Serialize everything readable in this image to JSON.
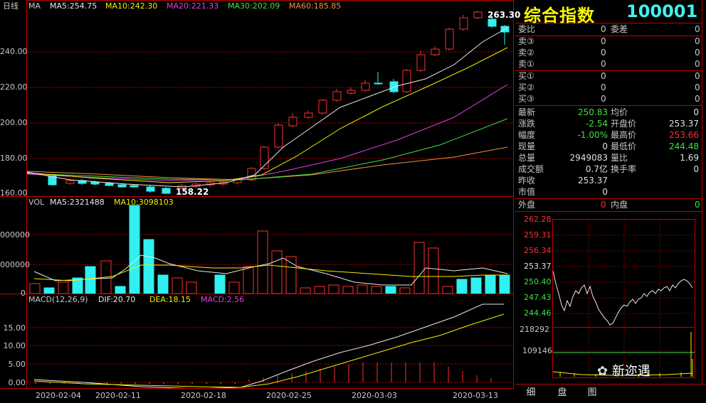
{
  "kline": {
    "period_label": "日线",
    "ma_labels": [
      {
        "text": "MA",
        "color": "#c8c8c8"
      },
      {
        "text": "MA5:254.75",
        "color": "#e8e8e8"
      },
      {
        "text": "MA10:242.30",
        "color": "#f0f000"
      },
      {
        "text": "MA20:221.33",
        "color": "#e040e0"
      },
      {
        "text": "MA30:202.09",
        "color": "#40e040"
      },
      {
        "text": "MA60:185.85",
        "color": "#f09040"
      }
    ],
    "y_ticks": [
      "240.00",
      "220.00",
      "200.00",
      "180.00",
      "160.00"
    ],
    "high_marker": "263.30",
    "low_marker": "158.22",
    "colors": {
      "up": "#ff3030",
      "down": "#30f0f0",
      "ma5": "#e8e8e8",
      "ma10": "#f0f000",
      "ma20": "#e040e0",
      "ma30": "#40e040",
      "ma60": "#f09040"
    }
  },
  "vol": {
    "labels": [
      {
        "text": "VOL",
        "color": "#c8c8c8"
      },
      {
        "text": "MA5:2321488",
        "color": "#e8e8e8"
      },
      {
        "text": "MA10:3098103",
        "color": "#f0f000"
      }
    ],
    "y_ticks": [
      "000000",
      "000000",
      "0"
    ]
  },
  "macd": {
    "labels": [
      {
        "text": "MACD(12,26,9)",
        "color": "#c8c8c8"
      },
      {
        "text": "DIF:20.70",
        "color": "#e8e8e8"
      },
      {
        "text": "DEA:18.15",
        "color": "#f0f000"
      },
      {
        "text": "MACD:2.56",
        "color": "#e040e0"
      }
    ],
    "y_ticks": [
      "15.00",
      "10.00",
      "5.00",
      "0.00"
    ]
  },
  "dates": [
    "2020-02-04",
    "2020-02-11",
    "2020-02-18",
    "2020-02-25",
    "2020-03-03",
    "2020-03-13"
  ],
  "quote": {
    "name": "综合指数",
    "code": "100001",
    "weibi_label": "委比",
    "weibi": "0",
    "weicha_label": "委差",
    "weicha": "0",
    "asks": [
      {
        "label": "卖③",
        "price": "0",
        "vol": "0"
      },
      {
        "label": "卖②",
        "price": "0",
        "vol": "0"
      },
      {
        "label": "卖①",
        "price": "0",
        "vol": "0"
      }
    ],
    "bids": [
      {
        "label": "买①",
        "price": "0",
        "vol": "0"
      },
      {
        "label": "买②",
        "price": "0",
        "vol": "0"
      },
      {
        "label": "买③",
        "price": "0",
        "vol": "0"
      }
    ],
    "stats": [
      {
        "l1": "最新",
        "v1": "250.83",
        "c1": "#40e040",
        "l2": "均价",
        "v2": "0",
        "c2": "#e0e0e0"
      },
      {
        "l1": "涨跌",
        "v1": "-2.54",
        "c1": "#40e040",
        "l2": "开盘价",
        "v2": "253.37",
        "c2": "#e0e0e0"
      },
      {
        "l1": "幅度",
        "v1": "-1.00%",
        "c1": "#40e040",
        "l2": "最高价",
        "v2": "253.66",
        "c2": "#ff3030"
      },
      {
        "l1": "现量",
        "v1": "0",
        "c1": "#e0e0e0",
        "l2": "最低价",
        "v2": "244.48",
        "c2": "#40e040"
      },
      {
        "l1": "总量",
        "v1": "2949083",
        "c1": "#e0e0e0",
        "l2": "量比",
        "v2": "1.69",
        "c2": "#e0e0e0"
      },
      {
        "l1": "成交额",
        "v1": "0.7亿",
        "c1": "#e0e0e0",
        "l2": "换手率",
        "v2": "0",
        "c2": "#e0e0e0"
      },
      {
        "l1": "昨收",
        "v1": "253.37",
        "c1": "#e0e0e0",
        "l2": "",
        "v2": "",
        "c2": "#e0e0e0"
      },
      {
        "l1": "市值",
        "v1": "0",
        "c1": "#e0e0e0",
        "l2": "",
        "v2": "",
        "c2": "#e0e0e0"
      }
    ],
    "waipan_label": "外盘",
    "waipan": "0",
    "neipan_label": "内盘",
    "neipan": "0"
  },
  "intraday": {
    "price_ticks": [
      "262.28",
      "259.31",
      "256.34",
      "253.37",
      "250.40",
      "247.43",
      "244.46"
    ],
    "vol_ticks": [
      "218292",
      "109146"
    ]
  },
  "watermark": "新迩遇",
  "tabs": [
    "细",
    "盘",
    "图"
  ]
}
